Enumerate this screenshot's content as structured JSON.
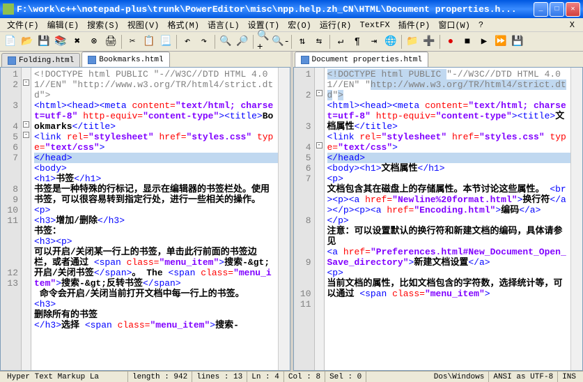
{
  "title": "F:\\work\\c++\\notepad-plus\\trunk\\PowerEditor\\misc\\npp.help.zh_CN\\HTML\\Document properties.h...",
  "menus": [
    "文件(F)",
    "编辑(E)",
    "搜索(S)",
    "视图(V)",
    "格式(M)",
    "语言(L)",
    "设置(T)",
    "宏(O)",
    "运行(R)",
    "TextFX",
    "插件(P)",
    "窗口(W)",
    "?"
  ],
  "left_tabs": [
    {
      "label": "Folding.html",
      "active": false
    },
    {
      "label": "Bookmarks.html",
      "active": true
    }
  ],
  "right_tabs": [
    {
      "label": "Document properties.html",
      "active": true
    }
  ],
  "left_lines": [
    "1",
    "2",
    "",
    "3",
    "",
    "4",
    "5",
    "6",
    "7",
    "",
    "",
    "8",
    "9",
    "10",
    "11",
    "",
    "",
    "",
    "",
    "12",
    "13",
    ""
  ],
  "right_lines": [
    "1",
    "",
    "2",
    "",
    "",
    "3",
    "",
    "4",
    "5",
    "6",
    "7",
    "",
    "",
    "",
    "8",
    "",
    "",
    "",
    "9",
    "",
    "",
    "10",
    "11",
    "",
    ""
  ],
  "status": {
    "lang": "Hyper Text Markup La",
    "length": "length : 942",
    "lines": "lines : 13",
    "ln": "Ln : 4",
    "col": "Col : 8",
    "sel": "Sel : 0",
    "eol": "Dos\\Windows",
    "enc": "ANSI as UTF-8",
    "mode": "INS"
  },
  "left_code": "<span class=\"gray\">&lt;!DOCTYPE html PUBLIC \"-//W3C//DTD HTML 4.01//EN\" \"http://www.w3.org/TR/html4/strict.dtd\"&gt;</span>\n<span class=\"tag\">&lt;html&gt;&lt;head&gt;&lt;meta</span> <span class=\"attr\">content=</span><span class=\"val\">\"text/html; charset=utf-8\"</span> <span class=\"attr\">http-equiv=</span><span class=\"val\">\"content-type\"</span><span class=\"tag\">&gt;&lt;title&gt;</span><span class=\"txt\">Bookmarks</span><span class=\"tag\">&lt;/title&gt;</span>\n<span class=\"tag\">&lt;link</span> <span class=\"attr\">rel=</span><span class=\"val\">\"stylesheet\"</span> <span class=\"attr\">href=</span><span class=\"val\">\"styles.css\"</span> <span class=\"attr\">type=</span><span class=\"val\">\"text/css\"</span><span class=\"tag\">&gt;</span>\n<span class=\"hl\"><span class=\"tag\">&lt;/head&gt;</span>                                        </span>\n<span class=\"tag\">&lt;body&gt;</span>\n<span class=\"tag\">&lt;h1&gt;</span><span class=\"txt\">书签</span><span class=\"tag\">&lt;/h1&gt;</span>\n<span class=\"txt\">书签是一种特殊的行标记，显示在编辑器的书签栏处。使用书签，可以很容易转到指定行处，进行一些相关的操作。</span>\n<span class=\"tag\">&lt;p&gt;</span>\n<span class=\"tag\">&lt;h3&gt;</span><span class=\"txt\">增加/删除</span><span class=\"tag\">&lt;/h3&gt;</span>\n<span class=\"txt\">书签：</span>\n<span class=\"tag\">&lt;h3&gt;&lt;p&gt;</span>\n<span class=\"txt\">可以开启/关闭某一行上的书签，单击此行前面的书签边栏，或者通过</span> <span class=\"tag\">&lt;span</span> <span class=\"attr\">class=</span><span class=\"val\">\"menu_item\"</span><span class=\"tag\">&gt;</span><span class=\"txt\">搜索-&amp;gt;开启/关闭书签</span><span class=\"tag\">&lt;/span&gt;</span><span class=\"txt\">。 The </span><span class=\"tag\">&lt;span</span> <span class=\"attr\">class=</span><span class=\"val\">\"menu_item\"</span><span class=\"tag\">&gt;</span><span class=\"txt\">搜索-&amp;gt;反转书签</span><span class=\"tag\">&lt;/span&gt;</span>\n<span class=\"txt\"> 命令会开启/关闭当前打开文档中每一行上的书签。</span>\n<span class=\"tag\">&lt;h3&gt;</span>\n<span class=\"txt\">删除所有的书签</span>\n<span class=\"tag\">&lt;/h3&gt;</span><span class=\"txt\">选择 </span><span class=\"tag\">&lt;span</span> <span class=\"attr\">class=</span><span class=\"val\">\"menu_item\"</span><span class=\"tag\">&gt;</span><span class=\"txt\">搜索-</span>",
  "right_code": "<span class=\"hl\"><span class=\"gray\">&lt;!DOCTYPE html PUBLIC </span></span><span class=\"gray\">\"-//W3C//DTD HTML 4.01//EN\" \"</span><span class=\"hl\"><span class=\"gray\">http://www.w3.org/TR/html4/strict.dtd</span></span><span class=\"gray\">\"</span><span class=\"hl\"><span class=\"gray\">&gt;</span></span>\n<span class=\"tag\">&lt;html&gt;&lt;head&gt;&lt;meta</span> <span class=\"attr\">content=</span><span class=\"val\">\"text/html; charset=utf-8\"</span> <span class=\"attr\">http-equiv=</span><span class=\"val\">\"content-type\"</span><span class=\"tag\">&gt;&lt;title&gt;</span><span class=\"txt\">文档属性</span><span class=\"tag\">&lt;/title&gt;</span>\n<span class=\"tag\">&lt;link</span> <span class=\"attr\">rel=</span><span class=\"val\">\"stylesheet\"</span> <span class=\"attr\">href=</span><span class=\"val\">\"styles.css\"</span> <span class=\"attr\">type=</span><span class=\"val\">\"text/css\"</span><span class=\"tag\">&gt;</span>\n<span class=\"hl\"><span class=\"tag\">&lt;/head&gt;</span>                                      </span>\n<span class=\"tag\">&lt;body&gt;&lt;h1&gt;</span><span class=\"txt\">文档属性</span><span class=\"tag\">&lt;/h1&gt;</span>\n<span class=\"tag\">&lt;p&gt;</span>\n<span class=\"txt\">文档包含其在磁盘上的存储属性。本节讨论这些属性。</span> <span class=\"tag\">&lt;br&gt;&lt;p&gt;&lt;a</span> <span class=\"attr\">href=</span><span class=\"val\">\"Newline%20format.html\"</span><span class=\"tag\">&gt;</span><span class=\"txt\">换行符</span><span class=\"tag\">&lt;/a&gt;&lt;/p&gt;&lt;p&gt;&lt;a</span> <span class=\"attr\">href=</span><span class=\"val\">\"Encoding.html\"</span><span class=\"tag\">&gt;</span><span class=\"txt\">编码</span><span class=\"tag\">&lt;/a&gt;</span>\n<span class=\"tag\">&lt;/p&gt;</span>\n<span class=\"txt\">注意：可以设置默认的换行符和新建文档的编码，具体请参见</span>\n<span class=\"tag\">&lt;a</span> <span class=\"attr\">href=</span><span class=\"val\">\"Preferences.html#New_Document_Open_Save_directory\"</span><span class=\"tag\">&gt;</span><span class=\"txt\">新建文档设置</span><span class=\"tag\">&lt;/a&gt;</span>\n<span class=\"tag\">&lt;p&gt;</span>\n<span class=\"txt\">当前文档的属性，比如文档包含的字符数，选择统计等，可以通过 </span><span class=\"tag\">&lt;span</span> <span class=\"attr\">class=</span><span class=\"val\">\"menu_item\"</span><span class=\"tag\">&gt;</span>"
}
